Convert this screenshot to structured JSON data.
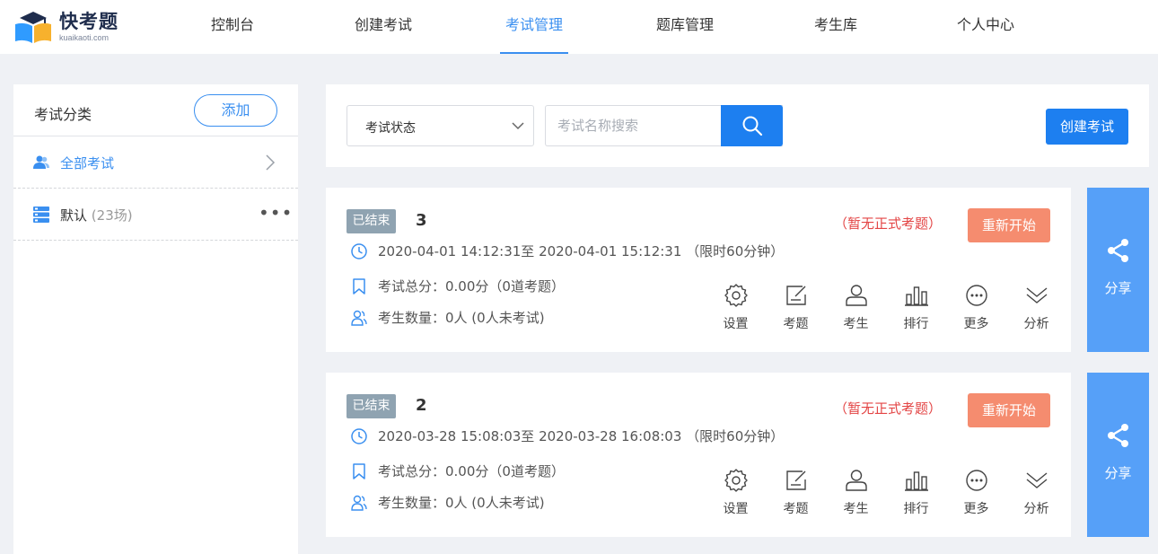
{
  "header": {
    "logo_main": "快考题",
    "logo_sub": "kuaikaoti.com",
    "nav": [
      {
        "label": "控制台"
      },
      {
        "label": "创建考试"
      },
      {
        "label": "考试管理"
      },
      {
        "label": "题库管理"
      },
      {
        "label": "考生库"
      },
      {
        "label": "个人中心"
      }
    ],
    "active_nav": "考试管理"
  },
  "sidebar": {
    "title": "考试分类",
    "add_label": "添加",
    "items": [
      {
        "label": "全部考试",
        "icon": "users-icon"
      },
      {
        "label": "默认",
        "count": "(23场)",
        "icon": "database-icon"
      }
    ],
    "more_label": "•••"
  },
  "toolbar": {
    "status_select": "考试状态",
    "search_placeholder": "考试名称搜索",
    "create_label": "创建考试"
  },
  "exams": [
    {
      "status": "已结束",
      "number": "3",
      "warning": "（暂无正式考题）",
      "restart_label": "重新开始",
      "time": "2020-04-01 14:12:31至 2020-04-01 15:12:31 （限时60分钟）",
      "total_score": "考试总分：0.00分（0道考题）",
      "examinees": "考生数量：0人 (0人未考试)",
      "share_label": "分享"
    },
    {
      "status": "已结束",
      "number": "2",
      "warning": "（暂无正式考题）",
      "restart_label": "重新开始",
      "time": "2020-03-28 15:08:03至 2020-03-28 16:08:03 （限时60分钟）",
      "total_score": "考试总分：0.00分（0道考题）",
      "examinees": "考生数量：0人 (0人未考试)",
      "share_label": "分享"
    }
  ],
  "actions": [
    {
      "label": "设置",
      "icon": "gear-icon"
    },
    {
      "label": "考题",
      "icon": "edit-icon"
    },
    {
      "label": "考生",
      "icon": "user-icon"
    },
    {
      "label": "排行",
      "icon": "bar-chart-icon"
    },
    {
      "label": "更多",
      "icon": "more-icon"
    },
    {
      "label": "分析",
      "icon": "double-chevron-down-icon"
    }
  ],
  "colors": {
    "primary": "#1d7ff0",
    "accent_text": "#3a8ff0",
    "share_bg": "#56a0f8",
    "restart_bg": "#f58c6f",
    "warning": "#e34545",
    "badge_bg": "#8fa3b1",
    "page_bg": "#eff1f5"
  }
}
